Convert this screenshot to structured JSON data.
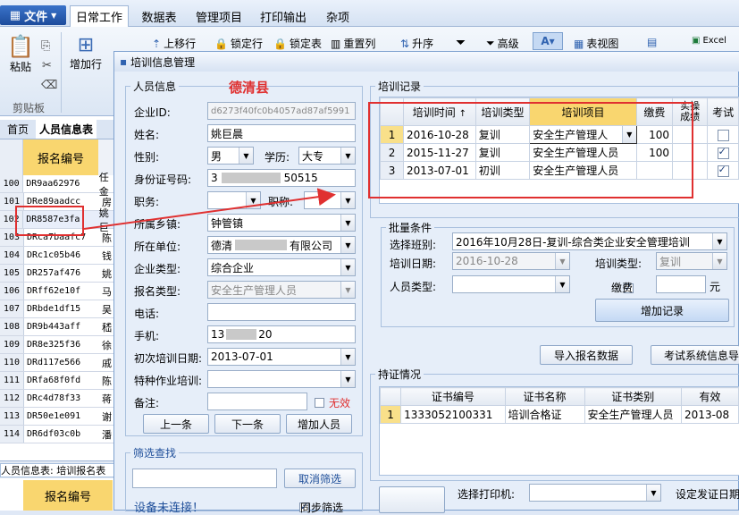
{
  "ribbon": {
    "file_label": "文件",
    "tabs": [
      "日常工作",
      "数据表",
      "管理项目",
      "打印输出",
      "杂项"
    ],
    "paste_label": "粘贴",
    "clipboard_label": "剪贴板",
    "add_row_label": "增加行",
    "move_up_label": "上移行",
    "lock_row_label": "锁定行",
    "lock_table_label": "锁定表",
    "reset_col_label": "重置列",
    "sort_asc_label": "升序",
    "advanced_label": "高级",
    "table_view_label": "表视图",
    "excel_label": "Excel"
  },
  "left": {
    "tab_home": "首页",
    "tab_people": "人员信息表",
    "col_header": "报名编号",
    "rows": [
      {
        "n": "100",
        "code": "DR9aa62976",
        "extra": "任金"
      },
      {
        "n": "101",
        "code": "DRe89aadcc",
        "extra": "房"
      },
      {
        "n": "102",
        "code": "DR8587e3fa",
        "extra": "姚巨"
      },
      {
        "n": "103",
        "code": "DRca7baafc7",
        "extra": "陈"
      },
      {
        "n": "104",
        "code": "DRc1c05b46",
        "extra": "钱"
      },
      {
        "n": "105",
        "code": "DR257af476",
        "extra": "姚"
      },
      {
        "n": "106",
        "code": "DRff62e10f",
        "extra": "马"
      },
      {
        "n": "107",
        "code": "DRbde1df15",
        "extra": "吴"
      },
      {
        "n": "108",
        "code": "DR9b443aff",
        "extra": "嵇"
      },
      {
        "n": "109",
        "code": "DR8e325f36",
        "extra": "徐"
      },
      {
        "n": "110",
        "code": "DRd117e566",
        "extra": "戚"
      },
      {
        "n": "111",
        "code": "DRfa68f0fd",
        "extra": "陈"
      },
      {
        "n": "112",
        "code": "DRc4d78f33",
        "extra": "蒋"
      },
      {
        "n": "113",
        "code": "DR50e1e091",
        "extra": "谢"
      },
      {
        "n": "114",
        "code": "DR6df03c0b",
        "extra": "潘"
      }
    ],
    "bottom_tabs": "人员信息表: 培训报名表",
    "bottom_header": "报名编号"
  },
  "dialog": {
    "title": "培训信息管理",
    "person_group": "人员信息",
    "county": "德清县",
    "enterprise_id_label": "企业ID:",
    "enterprise_id": "d6273f40fc0b4057ad87af5991",
    "name_label": "姓名:",
    "name": "姚巨晨",
    "gender_label": "性别:",
    "gender": "男",
    "edu_label": "学历:",
    "edu": "大专",
    "idno_label": "身份证号码:",
    "idno_start": "3",
    "idno_end": "50515",
    "job_label": "职务:",
    "title2_label": "职称:",
    "town_label": "所属乡镇:",
    "town": "钟管镇",
    "unit_label": "所在单位:",
    "unit_start": "德清",
    "unit_end": "有限公司",
    "etype_label": "企业类型:",
    "etype": "综合企业",
    "regtype_label": "报名类型:",
    "regtype": "安全生产管理人员",
    "phone_label": "电话:",
    "mobile_label": "手机:",
    "mobile_start": "13",
    "mobile_end": "20",
    "firstdate_label": "初次培训日期:",
    "firstdate": "2013-07-01",
    "special_label": "特种作业培训:",
    "note_label": "备注:",
    "invalid_label": "无效",
    "prev_btn": "上一条",
    "next_btn": "下一条",
    "add_person_btn": "增加人员",
    "filter_group": "筛选查找",
    "cancel_filter_btn": "取消筛选",
    "device_status": "设备未连接！",
    "sync_filter_label": "同步筛选",
    "training_group": "培训记录",
    "training_headers": [
      "培训时间",
      "培训类型",
      "培训项目",
      "缴费",
      "实操成绩",
      "考试"
    ],
    "training_rows": [
      {
        "n": "1",
        "date": "2016-10-28",
        "type": "复训",
        "item": "安全生产管理人",
        "fee": "100",
        "exam": false
      },
      {
        "n": "2",
        "date": "2015-11-27",
        "type": "复训",
        "item": "安全生产管理人员",
        "fee": "100",
        "exam": true
      },
      {
        "n": "3",
        "date": "2013-07-01",
        "type": "初训",
        "item": "安全生产管理人员",
        "fee": "",
        "exam": true
      }
    ],
    "batch_group": "批量条件",
    "class_label": "选择班别:",
    "class_value": "2016年10月28日-复训-综合类企业安全管理培训",
    "bdate_label": "培训日期:",
    "bdate": "2016-10-28",
    "btype_label": "培训类型:",
    "btype": "复训",
    "ptype_label": "人员类型:",
    "fee_label": "缴费",
    "yuan_label": "元",
    "add_record_btn": "增加记录",
    "import_btn": "导入报名数据",
    "exam_sys_btn": "考试系统信息导",
    "cert_group": "持证情况",
    "cert_headers": [
      "证书编号",
      "证书名称",
      "证书类别",
      "有效"
    ],
    "cert_rows": [
      {
        "n": "1",
        "no": "1333052100331",
        "name": "培训合格证",
        "cat": "安全生产管理人员",
        "valid": "2013-08"
      }
    ],
    "printer_label": "选择打印机:",
    "issue_date_label": "设定发证日期"
  }
}
